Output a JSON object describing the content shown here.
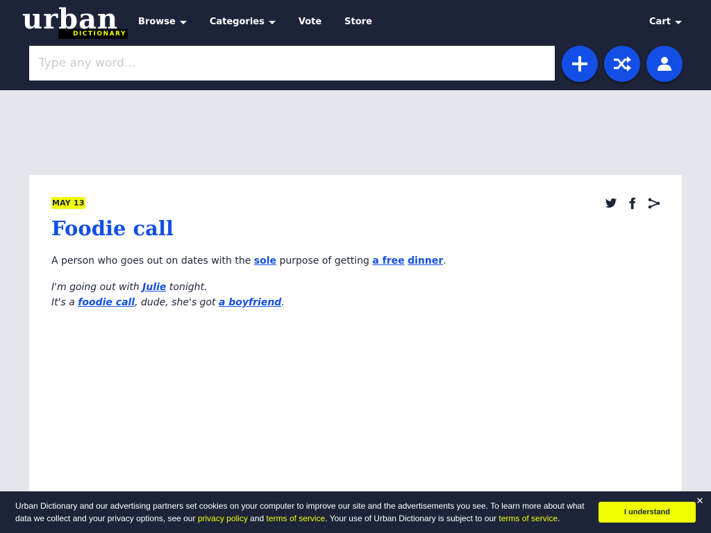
{
  "header": {
    "logo": {
      "line1": "urban",
      "line2": "DICTIONARY"
    },
    "nav": [
      {
        "label": "Browse",
        "has_dropdown": true
      },
      {
        "label": "Categories",
        "has_dropdown": true
      },
      {
        "label": "Vote",
        "has_dropdown": false
      },
      {
        "label": "Store",
        "has_dropdown": false
      }
    ],
    "cart": {
      "label": "Cart"
    },
    "search": {
      "placeholder": "Type any word..."
    },
    "actions": [
      {
        "icon": "plus-icon"
      },
      {
        "icon": "shuffle-icon"
      },
      {
        "icon": "user-icon"
      }
    ]
  },
  "definition": {
    "date": "MAY 13",
    "word": "Foodie call",
    "meaning": {
      "t1": "A person who goes out on dates with the ",
      "l1": "sole",
      "t2": " purpose of getting ",
      "l2": "a free",
      "t3": " ",
      "l3": "dinner",
      "t4": "."
    },
    "example": {
      "t1": "I'm going out with ",
      "l1": "Julie",
      "t2": " tonight.",
      "t3": "It's a ",
      "l2": "foodie call",
      "t4": ", dude, she's got ",
      "l3": "a boyfriend",
      "t5": "."
    },
    "share_icons": [
      "twitter-icon",
      "facebook-icon",
      "share-icon"
    ]
  },
  "cookie": {
    "text1": "Urban Dictionary and our advertising partners set cookies on your computer to improve our site and the advertisements you see. To learn more about what data we collect and your privacy options, see our ",
    "link1": "privacy policy",
    "text2": " and ",
    "link2": "terms of service",
    "text3": ". Your use of Urban Dictionary is subject to our ",
    "link3": "terms of service",
    "text4": ".",
    "button": "I understand",
    "close": "✕"
  },
  "colors": {
    "header_bg": "#1d2439",
    "accent_blue": "#134fe6",
    "highlight_yellow": "#efff00",
    "page_bg": "#e5e6eb"
  }
}
